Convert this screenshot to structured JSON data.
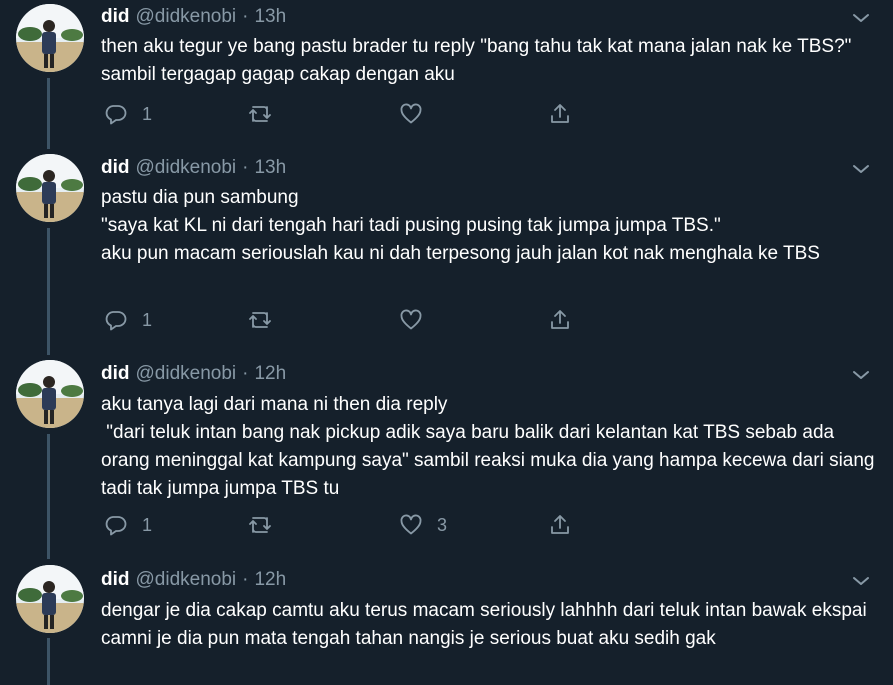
{
  "colors": {
    "background": "#15202b",
    "text": "#ffffff",
    "muted": "#8899a6",
    "thread_line": "#3d5466"
  },
  "tweets": [
    {
      "name": "did",
      "handle": "@didkenobi",
      "separator": "·",
      "time": "13h",
      "lines": [
        "then aku tegur ye bang pastu brader tu reply \"bang tahu tak kat mana jalan nak ke TBS?\" sambil tergagap gagap cakap dengan aku"
      ],
      "reply_count": "1",
      "retweet_count": "",
      "like_count": "",
      "icons": [
        "reply-icon",
        "retweet-icon",
        "heart-icon",
        "share-icon",
        "chevron-down-icon"
      ]
    },
    {
      "name": "did",
      "handle": "@didkenobi",
      "separator": "·",
      "time": "13h",
      "lines": [
        "pastu dia pun sambung",
        "\"saya kat KL ni dari tengah hari tadi pusing pusing tak jumpa jumpa TBS.\"",
        "aku pun macam seriouslah kau ni dah terpesong jauh jalan kot nak menghala ke TBS"
      ],
      "reply_count": "1",
      "retweet_count": "",
      "like_count": ""
    },
    {
      "name": "did",
      "handle": "@didkenobi",
      "separator": "·",
      "time": "12h",
      "lines": [
        "aku tanya lagi dari mana ni then dia reply",
        " \"dari teluk intan bang nak pickup adik saya baru balik dari kelantan kat TBS sebab ada orang meninggal kat kampung saya\" sambil reaksi muka dia yang hampa kecewa dari siang tadi tak jumpa jumpa TBS tu"
      ],
      "reply_count": "1",
      "retweet_count": "",
      "like_count": "3"
    },
    {
      "name": "did",
      "handle": "@didkenobi",
      "separator": "·",
      "time": "12h",
      "lines": [
        "dengar je dia cakap camtu aku terus macam seriously lahhhh dari teluk intan bawak ekspai camni je dia pun mata tengah tahan nangis je serious buat aku sedih gak"
      ],
      "reply_count": "",
      "retweet_count": "",
      "like_count": ""
    }
  ]
}
